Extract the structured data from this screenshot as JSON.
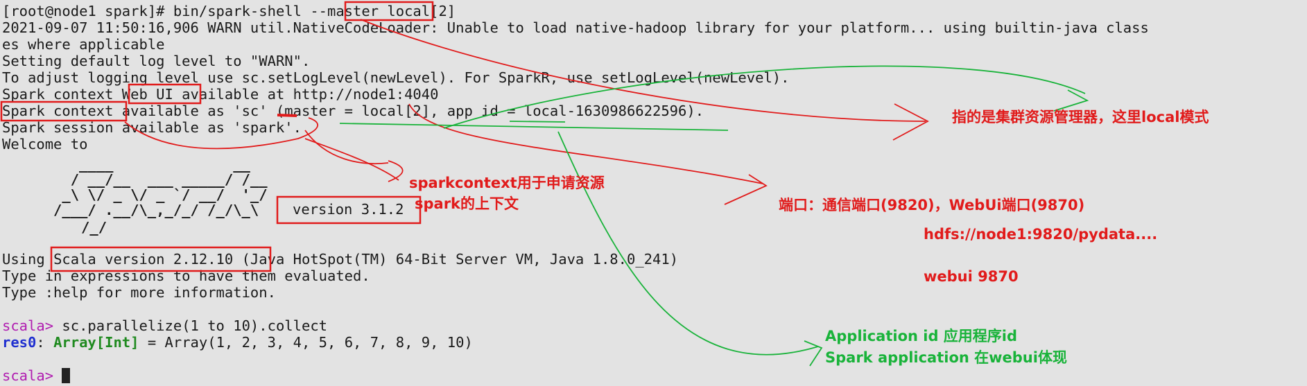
{
  "terminal": {
    "lines": [
      "[root@node1 spark]# bin/spark-shell --master local[2]",
      "2021-09-07 11:50:16,906 WARN util.NativeCodeLoader: Unable to load native-hadoop library for your platform... using builtin-java class",
      "es where applicable",
      "Setting default log level to \"WARN\".",
      "To adjust logging level use sc.setLogLevel(newLevel). For SparkR, use setLogLevel(newLevel).",
      "Spark context Web UI available at http://node1:4040",
      "Spark context available as 'sc' (master = local[2], app id = local-1630986622596).",
      "Spark session available as 'spark'.",
      "Welcome to"
    ],
    "ascii_logo": "      ____              __\n     / __/__  ___ _____/ /__\n    _\\ \\/ _ \\/ _ `/ __/  '_/\n   /___/ .__/\\_,_/_/ /_/\\_\\",
    "ascii_logo_last": "      /_/",
    "version_text": "version 3.1.2",
    "using_prefix": "Using ",
    "scala_version": "Scala version 2.12.10",
    "using_suffix": " (Java HotSpot(TM) 64-Bit Server VM, Java 1.8.0_241)",
    "type_expr": "Type in expressions to have them evaluated.",
    "type_help": "Type :help for more information.",
    "prompt": "scala>",
    "command": " sc.parallelize(1 to 10).collect",
    "res_name": "res0",
    "res_colon": ": ",
    "res_type": "Array[Int]",
    "res_value": " = Array(1, 2, 3, 4, 5, 6, 7, 8, 9, 10)",
    "prompt2": "scala>"
  },
  "annotations": {
    "master_note": "指的是集群资源管理器，这里local模式",
    "sparkcontext_note": "sparkcontext用于申请资源",
    "spark_note": "spark的上下文",
    "port_note": "端口：通信端口(9820)，WebUi端口(9870)",
    "hdfs_note": "hdfs://node1:9820/pydata....",
    "webui_note": "webui 9870",
    "appid_note_1": "Application id 应用程序id",
    "appid_note_2": "Spark application 在webui体现"
  },
  "colors": {
    "background": "#e3e3e3",
    "text": "#1a1a1a",
    "prompt": "#b01cb0",
    "result_name": "#1f2fd0",
    "result_type": "#1f8a1f",
    "annotation_red": "#e11b1b",
    "annotation_green": "#19b33a"
  }
}
